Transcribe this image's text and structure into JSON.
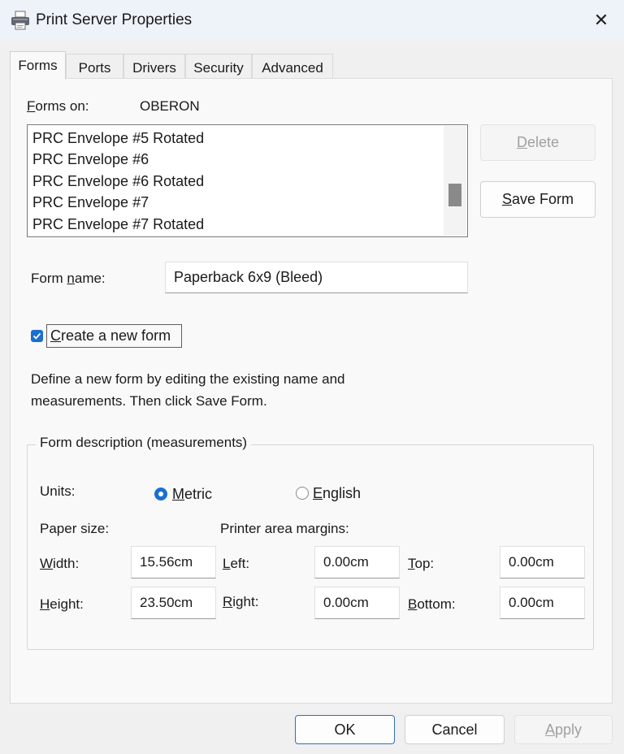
{
  "window": {
    "title": "Print Server Properties",
    "close_glyph": "✕"
  },
  "tabs": [
    {
      "label": "Forms",
      "active": true
    },
    {
      "label": "Ports",
      "active": false
    },
    {
      "label": "Drivers",
      "active": false
    },
    {
      "label": "Security",
      "active": false
    },
    {
      "label": "Advanced",
      "active": false
    }
  ],
  "forms": {
    "forms_on_label_u": "F",
    "forms_on_label_rest": "orms on:",
    "server_name": "OBERON",
    "list_items": [
      "PRC Envelope #5 Rotated",
      "PRC Envelope #6",
      "PRC Envelope #6 Rotated",
      "PRC Envelope #7",
      "PRC Envelope #7 Rotated"
    ],
    "delete_u": "D",
    "delete_rest": "elete",
    "save_u": "S",
    "save_rest": "ave Form",
    "form_name_pre": "Form ",
    "form_name_u": "n",
    "form_name_post": "ame:",
    "form_name_value": "Paperback 6x9 (Bleed)",
    "create_new_u": "C",
    "create_new_rest": "reate a new form",
    "create_new_checked": true,
    "description_line1": "Define a new form by editing the existing name and",
    "description_line2": "measurements. Then click Save Form."
  },
  "measurements": {
    "group_title": "Form description (measurements)",
    "units_label": "Units:",
    "metric_u": "M",
    "metric_rest": "etric",
    "english_u": "E",
    "english_rest": "nglish",
    "selected_unit": "Metric",
    "paper_size_label": "Paper size:",
    "margins_label": "Printer area margins:",
    "width_u": "W",
    "width_rest": "idth:",
    "width_value": "15.56cm",
    "height_u": "H",
    "height_rest": "eight:",
    "height_value": "23.50cm",
    "left_u": "L",
    "left_rest": "eft:",
    "left_value": "0.00cm",
    "right_u": "R",
    "right_rest": "ight:",
    "right_value": "0.00cm",
    "top_u": "T",
    "top_rest": "op:",
    "top_value": "0.00cm",
    "bottom_u": "B",
    "bottom_rest": "ottom:",
    "bottom_value": "0.00cm"
  },
  "footer": {
    "ok_label": "OK",
    "cancel_label": "Cancel",
    "apply_u": "A",
    "apply_rest": "pply"
  },
  "colors": {
    "accent": "#1b6fd1",
    "titlebar": "#eef2f9"
  }
}
